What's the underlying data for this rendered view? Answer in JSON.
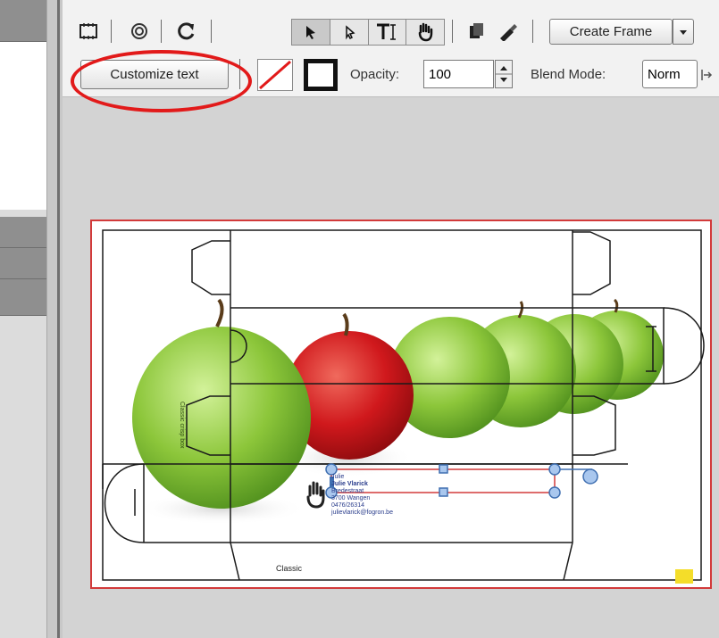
{
  "toolbar": {
    "create_frame_label": "Create Frame",
    "tools": [
      "crop-icon",
      "target-icon",
      "rotate-icon",
      "select-arrow-icon",
      "node-select-icon",
      "text-tool-icon",
      "hand-icon",
      "copy-icon",
      "eyedropper-icon"
    ]
  },
  "properties": {
    "customize_text_label": "Customize text",
    "opacity_label": "Opacity:",
    "opacity_value": "100",
    "blend_mode_label": "Blend Mode:",
    "blend_mode_value": "Norm"
  },
  "canvas": {
    "name_lines": [
      "Julie",
      "Julie Vlarick",
      "Bredestraat",
      "3700 Wangen",
      "0476/26314",
      "julievlarick@fogron.be"
    ],
    "side_label": "Classic crisp box",
    "bottom_label": "Classic",
    "colors": {
      "frame_border": "#d23a3a",
      "selection": "#d23a3a",
      "handle_fill": "#a9c7ee",
      "handle_stroke": "#3f6fb1",
      "corner_marker": "#f4dd29",
      "annotation": "#e21a1a"
    }
  }
}
